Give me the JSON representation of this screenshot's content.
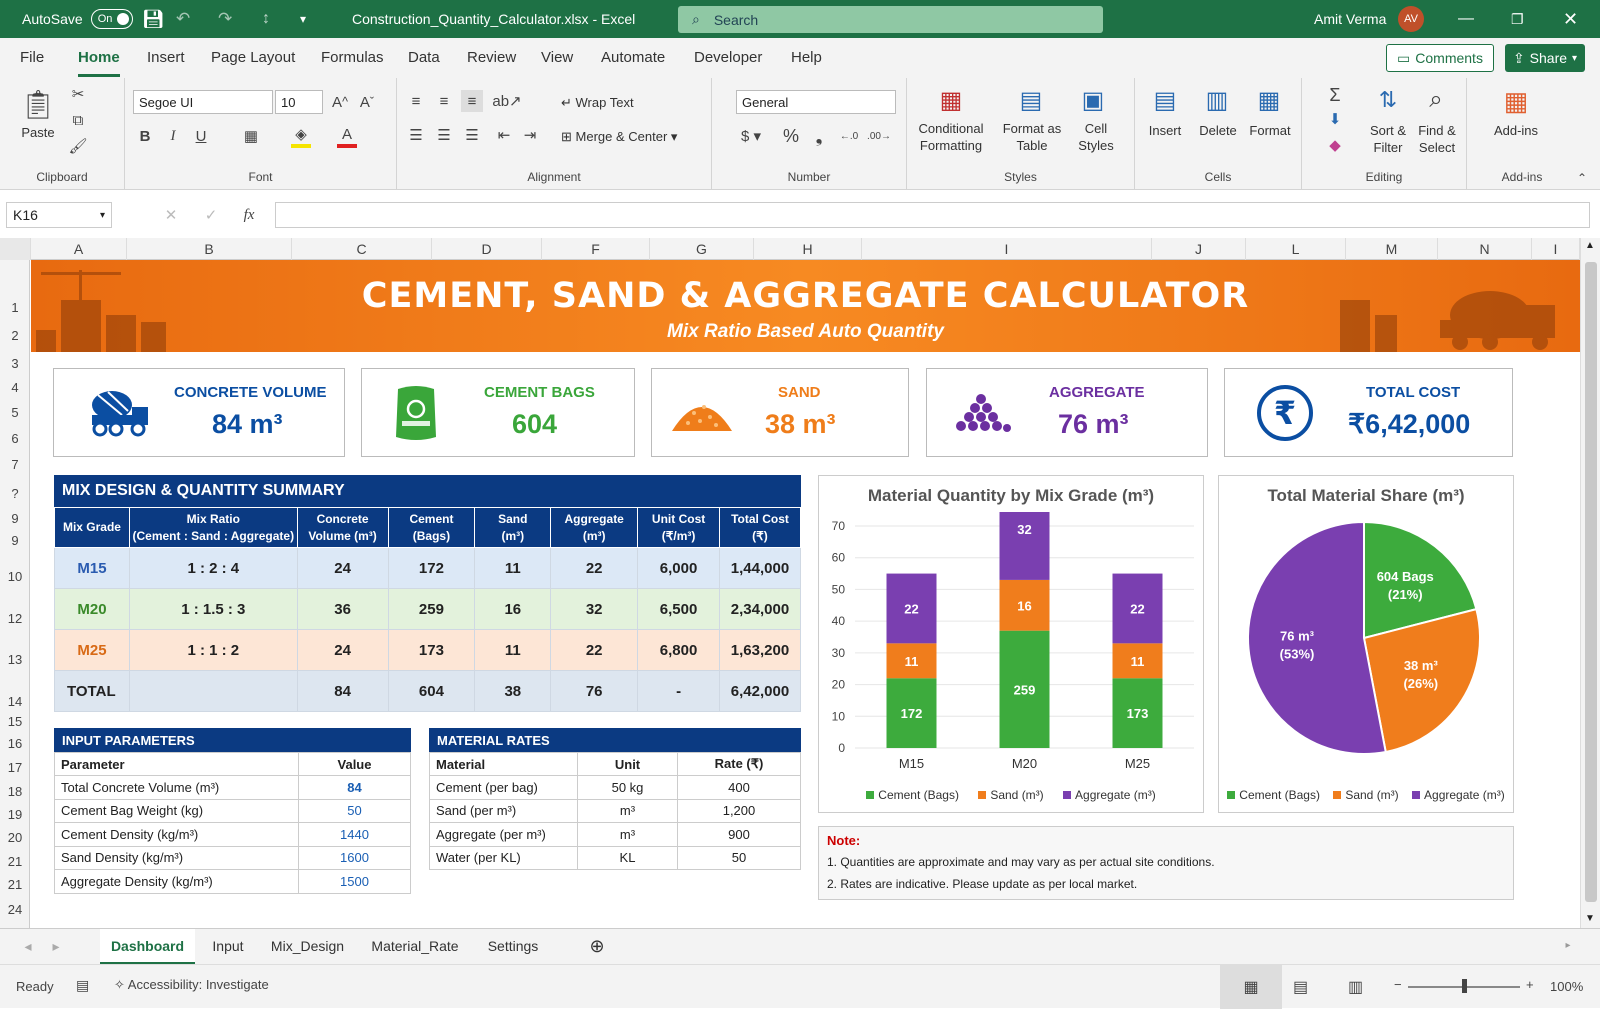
{
  "titlebar": {
    "autosave_label": "AutoSave",
    "autosave_state": "On",
    "filename": "Construction_Quantity_Calculator.xlsx",
    "app": "Excel",
    "search_placeholder": "Search",
    "user_name": "Amit Verma",
    "user_initials": "AV"
  },
  "menu": {
    "items": [
      "File",
      "Home",
      "Insert",
      "Page Layout",
      "Formulas",
      "Data",
      "Review",
      "View",
      "Automate",
      "Developer",
      "Help"
    ],
    "active": "Home",
    "comments_label": "Comments",
    "share_label": "Share"
  },
  "ribbon": {
    "clipboard": {
      "paste": "Paste",
      "label": "Clipboard"
    },
    "font": {
      "name": "Segoe UI",
      "size": "10",
      "label": "Font"
    },
    "alignment": {
      "wrap": "Wrap Text",
      "merge": "Merge & Center",
      "label": "Alignment"
    },
    "number": {
      "format": "General",
      "label": "Number"
    },
    "styles": {
      "cond": "Conditional Formatting",
      "table": "Format as Table",
      "cell": "Cell Styles",
      "label": "Styles"
    },
    "cells": {
      "insert": "Insert",
      "delete": "Delete",
      "format": "Format",
      "label": "Cells"
    },
    "editing": {
      "sort": "Sort & Filter",
      "find": "Find & Select",
      "label": "Editing"
    },
    "addins": {
      "btn": "Add-ins",
      "label": "Add-ins"
    }
  },
  "formula": {
    "namebox": "K16",
    "fx": "fx",
    "content": ""
  },
  "columns": [
    "A",
    "B",
    "C",
    "D",
    "F",
    "G",
    "H",
    "I",
    "J",
    "L",
    "M",
    "N",
    "I"
  ],
  "rows": [
    "1",
    "2",
    "3",
    "4",
    "5",
    "6",
    "7",
    "?",
    "9",
    "9",
    "10",
    "12",
    "13",
    "14",
    "15",
    "16",
    "17",
    "18",
    "19",
    "20",
    "21",
    "21",
    "24"
  ],
  "banner": {
    "title": "CEMENT, SAND & AGGREGATE CALCULATOR",
    "subtitle": "Mix Ratio Based Auto Quantity"
  },
  "kpis": [
    {
      "label": "CONCRETE VOLUME",
      "value": "84 m³",
      "color": "#0b4ea2",
      "icon": "concrete-mixer-icon"
    },
    {
      "label": "CEMENT BAGS",
      "value": "604",
      "color": "#3aa63a",
      "icon": "cement-bag-icon"
    },
    {
      "label": "SAND",
      "value": "38 m³",
      "color": "#ef7d1a",
      "icon": "sand-pile-icon"
    },
    {
      "label": "AGGREGATE",
      "value": "76 m³",
      "color": "#6b2fa0",
      "icon": "aggregate-pile-icon"
    },
    {
      "label": "TOTAL COST",
      "value": "₹6,42,000",
      "color": "#0b4ea2",
      "icon": "rupee-icon"
    }
  ],
  "summary": {
    "title": "MIX DESIGN & QUANTITY SUMMARY",
    "headers": [
      "Mix Grade",
      "Mix Ratio\n(Cement : Sand : Aggregate)",
      "Concrete\nVolume (m³)",
      "Cement\n(Bags)",
      "Sand\n(m³)",
      "Aggregate\n(m³)",
      "Unit Cost\n(₹/m³)",
      "Total Cost\n(₹)"
    ],
    "rows": [
      {
        "grade": "M15",
        "ratio": "1 : 2 : 4",
        "volume": "24",
        "cement": "172",
        "sand": "11",
        "aggregate": "22",
        "unit_cost": "6,000",
        "total": "1,44,000",
        "bg": "#dce8f6",
        "grade_color": "#2a5bb0"
      },
      {
        "grade": "M20",
        "ratio": "1 : 1.5 : 3",
        "volume": "36",
        "cement": "259",
        "sand": "16",
        "aggregate": "32",
        "unit_cost": "6,500",
        "total": "2,34,000",
        "bg": "#e3f2dc",
        "grade_color": "#3a8a2a"
      },
      {
        "grade": "M25",
        "ratio": "1 : 1 : 2",
        "volume": "24",
        "cement": "173",
        "sand": "11",
        "aggregate": "22",
        "unit_cost": "6,800",
        "total": "1,63,200",
        "bg": "#fde6d6",
        "grade_color": "#d86a16"
      }
    ],
    "total": {
      "label": "TOTAL",
      "ratio": "",
      "volume": "84",
      "cement": "604",
      "sand": "38",
      "aggregate": "76",
      "unit_cost": "-",
      "total": "6,42,000"
    }
  },
  "input_params": {
    "title": "INPUT PARAMETERS",
    "headers": [
      "Parameter",
      "Value"
    ],
    "rows": [
      [
        "Total Concrete Volume (m³)",
        "84"
      ],
      [
        "Cement Bag Weight (kg)",
        "50"
      ],
      [
        "Cement Density (kg/m³)",
        "1440"
      ],
      [
        "Sand Density (kg/m³)",
        "1600"
      ],
      [
        "Aggregate Density (kg/m³)",
        "1500"
      ]
    ]
  },
  "material_rates": {
    "title": "MATERIAL RATES",
    "headers": [
      "Material",
      "Unit",
      "Rate (₹)"
    ],
    "rows": [
      [
        "Cement (per bag)",
        "50 kg",
        "400"
      ],
      [
        "Sand (per m³)",
        "m³",
        "1,200"
      ],
      [
        "Aggregate (per m³)",
        "m³",
        "900"
      ],
      [
        "Water (per KL)",
        "KL",
        "50"
      ]
    ]
  },
  "chart_data": [
    {
      "type": "bar",
      "stacked": true,
      "title": "Material Quantity by Mix Grade (m³)",
      "categories": [
        "M15",
        "M20",
        "M25"
      ],
      "ylim": [
        0,
        70
      ],
      "yticks": [
        0,
        10,
        20,
        30,
        40,
        50,
        60,
        70
      ],
      "series": [
        {
          "name": "Cement (Bags)",
          "color": "#3dab3d",
          "values": [
            22,
            37,
            22
          ],
          "labels": [
            "172",
            "259",
            "173"
          ]
        },
        {
          "name": "Sand (m³)",
          "color": "#f07d1c",
          "values": [
            11,
            16,
            11
          ],
          "labels": [
            "11",
            "16",
            "11"
          ]
        },
        {
          "name": "Aggregate (m³)",
          "color": "#7a3fb0",
          "values": [
            22,
            32,
            22
          ],
          "labels": [
            "22",
            "32",
            "22"
          ]
        }
      ]
    },
    {
      "type": "pie",
      "title": "Total Material Share (m³)",
      "slices": [
        {
          "name": "Cement (Bags)",
          "value": 21,
          "label": "604 Bags",
          "pct": "(21%)",
          "color": "#3dab3d"
        },
        {
          "name": "Sand (m³)",
          "value": 26,
          "label": "38 m³",
          "pct": "(26%)",
          "color": "#f07d1c"
        },
        {
          "name": "Aggregate (m³)",
          "value": 53,
          "label": "76 m³",
          "pct": "(53%)",
          "color": "#7a3fb0"
        }
      ]
    }
  ],
  "note": {
    "title": "Note:",
    "lines": [
      "1. Quantities are approximate and may vary as per actual site conditions.",
      "2. Rates are indicative. Please update as per local market."
    ]
  },
  "sheet_tabs": {
    "items": [
      "Dashboard",
      "Input",
      "Mix_Design",
      "Material_Rate",
      "Settings"
    ],
    "active": "Dashboard"
  },
  "status": {
    "ready": "Ready",
    "accessibility": "Accessibility: Investigate",
    "zoom": "100%"
  }
}
